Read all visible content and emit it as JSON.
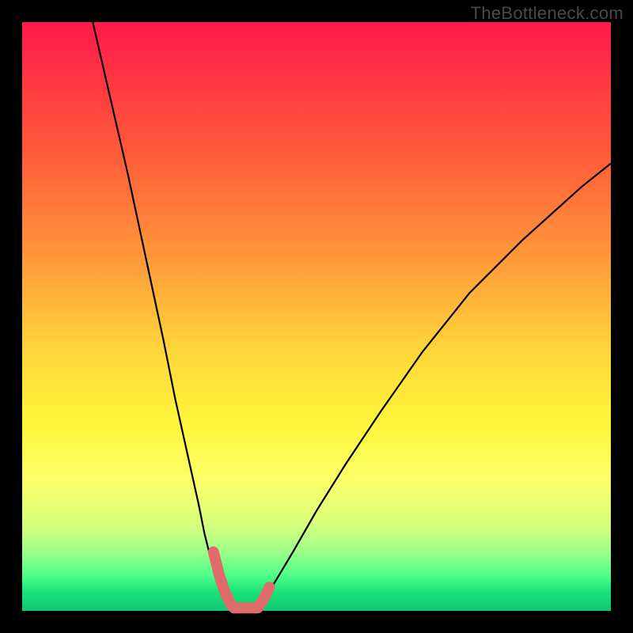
{
  "watermark": "TheBottleneck.com",
  "chart_data": {
    "type": "line",
    "title": "",
    "xlabel": "",
    "ylabel": "",
    "xlim": [
      0,
      100
    ],
    "ylim": [
      0,
      100
    ],
    "gradient_bands": [
      {
        "color": "#ff1a4b",
        "stop": 0
      },
      {
        "color": "#ff983a",
        "stop": 40
      },
      {
        "color": "#fff53a",
        "stop": 68
      },
      {
        "color": "#4dff8a",
        "stop": 94
      },
      {
        "color": "#10c86e",
        "stop": 100
      }
    ],
    "series": [
      {
        "name": "left-curve",
        "x": [
          12,
          15,
          18,
          21,
          24,
          26,
          28,
          30,
          31,
          32,
          33,
          34,
          35,
          36
        ],
        "y": [
          100,
          87,
          74,
          60,
          46,
          36,
          27,
          18,
          13,
          9,
          6,
          3,
          1,
          0
        ]
      },
      {
        "name": "right-curve",
        "x": [
          40,
          41,
          43,
          46,
          50,
          55,
          61,
          68,
          76,
          85,
          95,
          100
        ],
        "y": [
          0,
          2,
          5,
          10,
          17,
          25,
          34,
          44,
          54,
          63,
          72,
          76
        ]
      }
    ],
    "plateau": {
      "x_start": 36,
      "x_end": 40,
      "y": 0
    },
    "highlight": {
      "color": "#e06b6b",
      "thickness": 14,
      "segments": [
        {
          "x": [
            32.5,
            33,
            33.5,
            34,
            34.5,
            35,
            35.5,
            36
          ],
          "y": [
            10,
            8,
            6,
            4.5,
            3,
            2,
            1,
            0.5
          ]
        },
        {
          "x": [
            36,
            40,
            41,
            42
          ],
          "y": [
            0.5,
            0.5,
            2,
            4
          ]
        }
      ]
    }
  }
}
